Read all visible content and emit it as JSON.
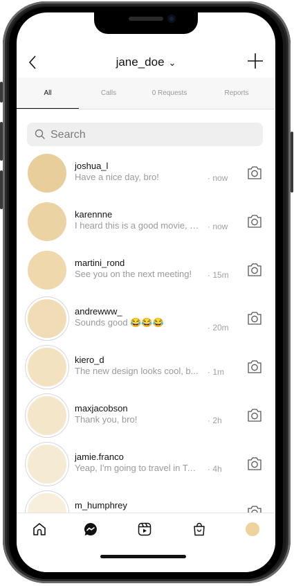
{
  "header": {
    "back_icon": "chevron-left-icon",
    "username": "jane_doe",
    "dropdown_icon": "chevron-down-icon",
    "new_icon": "plus-icon"
  },
  "tabs": [
    {
      "label": "All",
      "active": true
    },
    {
      "label": "Calls",
      "active": false
    },
    {
      "label": "0 Requests",
      "active": false
    },
    {
      "label": "Reports",
      "active": false
    }
  ],
  "search": {
    "placeholder": "Search",
    "value": ""
  },
  "messages": [
    {
      "user": "joshua_l",
      "text": "Have a nice day, bro!",
      "time": "· now",
      "color": "#E8CE9A",
      "story": false
    },
    {
      "user": "karennne",
      "text": "I heard this is a good movie, s...",
      "time": "· now",
      "color": "#EBD3A3",
      "story": false
    },
    {
      "user": "martini_rond",
      "text": "See you on the next meeting!",
      "time": "· 15m",
      "color": "#EED8AC",
      "story": false
    },
    {
      "user": "andrewww_",
      "text": "Sounds good 😂😂😂",
      "time": "· 20m",
      "color": "#F0DDB5",
      "story": true
    },
    {
      "user": "kiero_d",
      "text": "The new design looks cool, b...",
      "time": "· 1m",
      "color": "#F2E2BF",
      "story": true
    },
    {
      "user": "maxjacobson",
      "text": "Thank you, bro!",
      "time": "· 2h",
      "color": "#F4E6C8",
      "story": true
    },
    {
      "user": "jamie.franco",
      "text": "Yeap, I'm going to travel in To...",
      "time": "· 4h",
      "color": "#F5EAD2",
      "story": true
    },
    {
      "user": "m_humphrey",
      "text": "",
      "time": "",
      "color": "#F7EEDB",
      "story": true
    }
  ],
  "bottom_nav": [
    "home-icon",
    "messenger-icon",
    "reels-icon",
    "shop-icon",
    "profile-avatar"
  ],
  "colors": {
    "profile_avatar": "#EED39F",
    "text_primary": "#111111",
    "text_secondary": "#9A9A9A"
  }
}
